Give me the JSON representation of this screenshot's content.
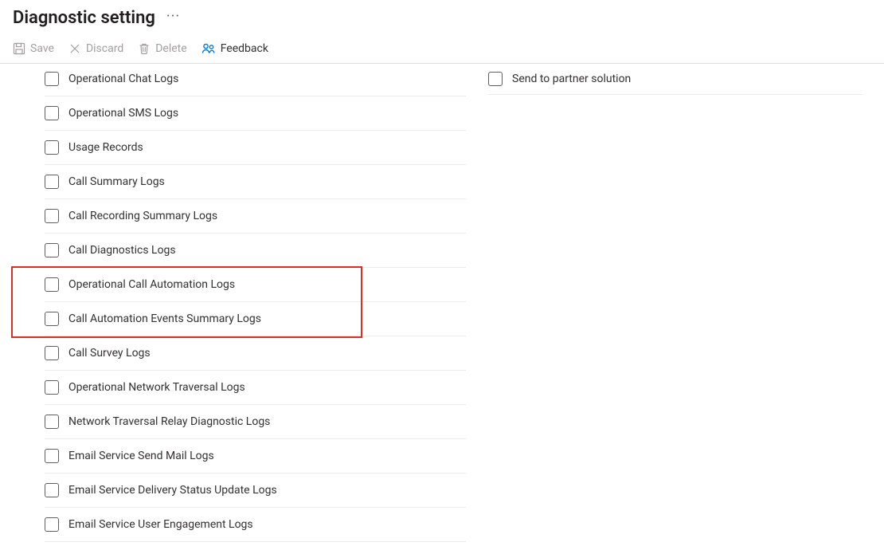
{
  "header": {
    "title": "Diagnostic setting"
  },
  "toolbar": {
    "save_label": "Save",
    "discard_label": "Discard",
    "delete_label": "Delete",
    "feedback_label": "Feedback"
  },
  "log_categories": [
    {
      "id": "operational-chat-logs",
      "label": "Operational Chat Logs",
      "checked": false
    },
    {
      "id": "operational-sms-logs",
      "label": "Operational SMS Logs",
      "checked": false
    },
    {
      "id": "usage-records",
      "label": "Usage Records",
      "checked": false
    },
    {
      "id": "call-summary-logs",
      "label": "Call Summary Logs",
      "checked": false
    },
    {
      "id": "call-recording-summary-logs",
      "label": "Call Recording Summary Logs",
      "checked": false
    },
    {
      "id": "call-diagnostics-logs",
      "label": "Call Diagnostics Logs",
      "checked": false
    },
    {
      "id": "operational-call-automation-logs",
      "label": "Operational Call Automation Logs",
      "checked": false,
      "highlighted": true
    },
    {
      "id": "call-automation-events-summary-logs",
      "label": "Call Automation Events Summary Logs",
      "checked": false,
      "highlighted": true
    },
    {
      "id": "call-survey-logs",
      "label": "Call Survey Logs",
      "checked": false
    },
    {
      "id": "operational-network-traversal-logs",
      "label": "Operational Network Traversal Logs",
      "checked": false
    },
    {
      "id": "network-traversal-relay-diagnostic-logs",
      "label": "Network Traversal Relay Diagnostic Logs",
      "checked": false
    },
    {
      "id": "email-service-send-mail-logs",
      "label": "Email Service Send Mail Logs",
      "checked": false
    },
    {
      "id": "email-service-delivery-status-update-logs",
      "label": "Email Service Delivery Status Update Logs",
      "checked": false
    },
    {
      "id": "email-service-user-engagement-logs",
      "label": "Email Service User Engagement Logs",
      "checked": false
    }
  ],
  "destinations": [
    {
      "id": "send-to-partner-solution",
      "label": "Send to partner solution",
      "checked": false
    }
  ]
}
